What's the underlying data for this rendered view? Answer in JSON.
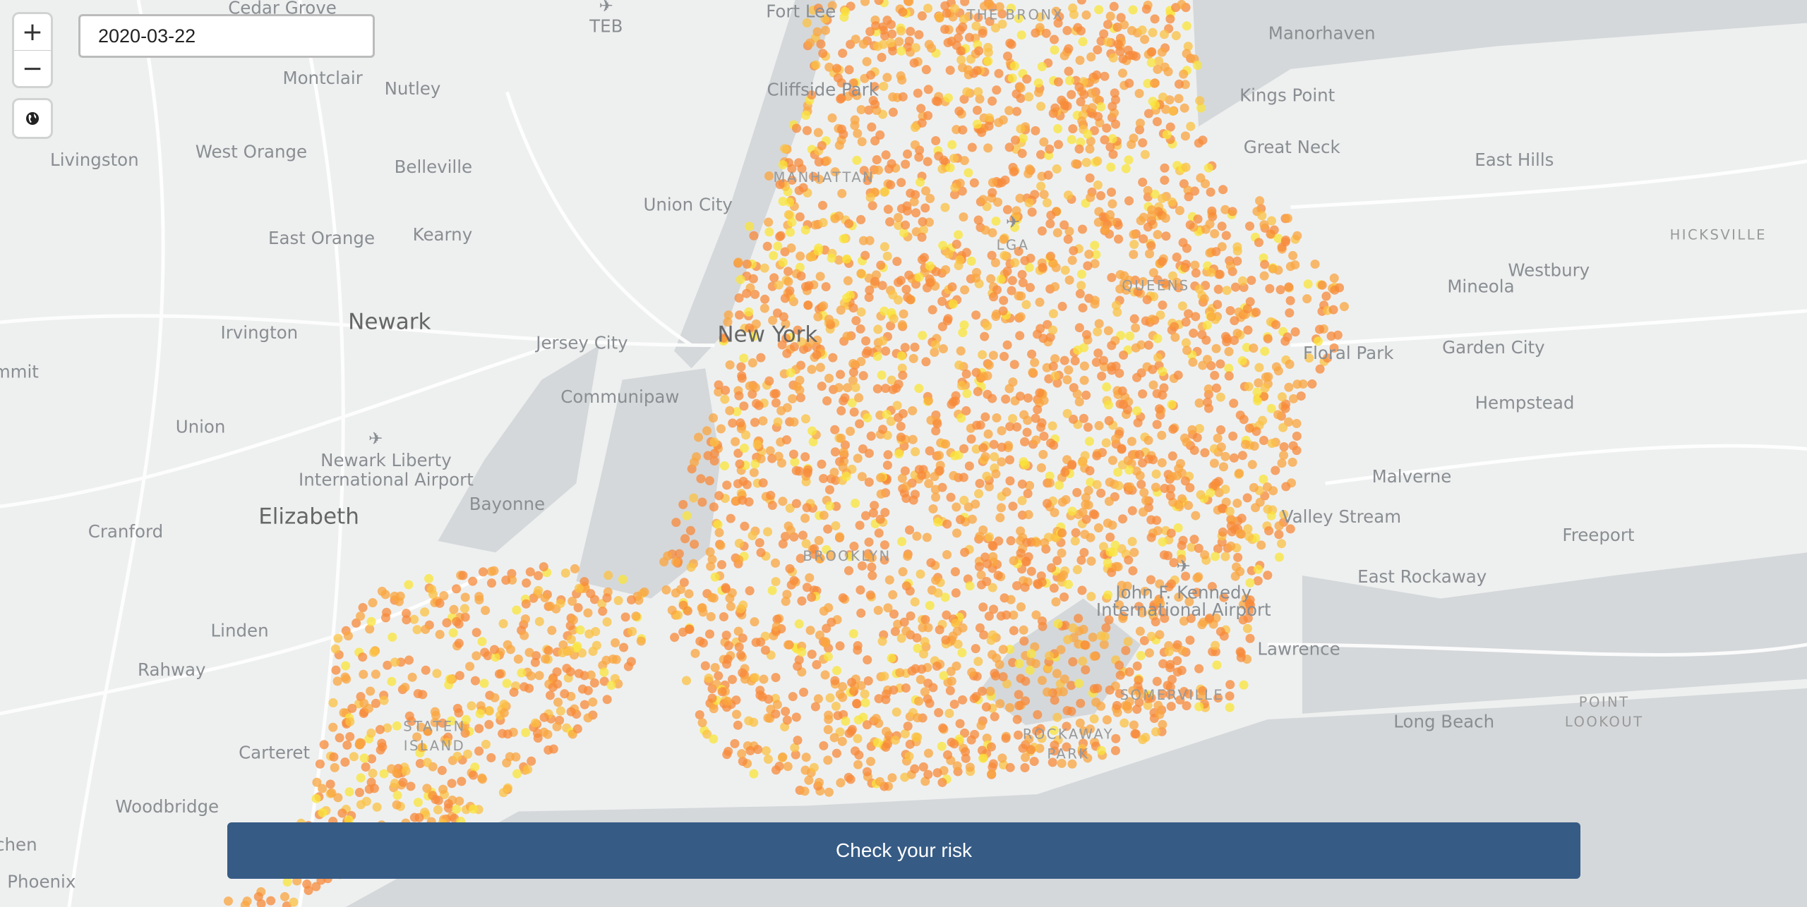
{
  "map": {
    "land_color": "#eef0f0",
    "water_color": "#d5d8da",
    "road_color": "#ffffff",
    "dot_colors": [
      "#f7893a",
      "#f9a53f",
      "#fbc243",
      "#f9e43a"
    ],
    "labels": [
      "Cedar Grove",
      "TEB",
      "Fort Lee",
      "THE BRONX",
      "Manorhaven",
      "Montclair",
      "Nutley",
      "Cliffside Park",
      "Kings Point",
      "Livingston",
      "West Orange",
      "Belleville",
      "Great Neck",
      "East Hills",
      "MANHATTAN",
      "Union City",
      "East Orange",
      "Kearny",
      "LGA",
      "HICKSVILLE",
      "QUEENS",
      "Mineola",
      "Westbury",
      "Newark",
      "Irvington",
      "Jersey City",
      "New York",
      "Floral Park",
      "Garden City",
      "mmit",
      "Communipaw",
      "Union",
      "Hempstead",
      "Newark Liberty",
      "International Airport",
      "Malverne",
      "Bayonne",
      "Cranford",
      "Elizabeth",
      "Valley Stream",
      "Freeport",
      "BROOKLYN",
      "East Rockaway",
      "John F. Kennedy",
      "International Airport",
      "Linden",
      "Lawrence",
      "Rahway",
      "STATEN",
      "ISLAND",
      "SOMERVILLE",
      "POINT",
      "LOOKOUT",
      "Long Beach",
      "ROCKAWAY",
      "PARK",
      "Carteret",
      "Woodbridge",
      "chen",
      "Phoenix"
    ],
    "airports": [
      "teb-airport",
      "lga-airport",
      "ewr-airport",
      "jfk-airport"
    ]
  },
  "controls": {
    "zoom_in": "+",
    "zoom_out": "−",
    "globe_icon": "globe-icon"
  },
  "date_input": {
    "value": "2020-03-22"
  },
  "risk_button": {
    "label": "Check your risk"
  }
}
